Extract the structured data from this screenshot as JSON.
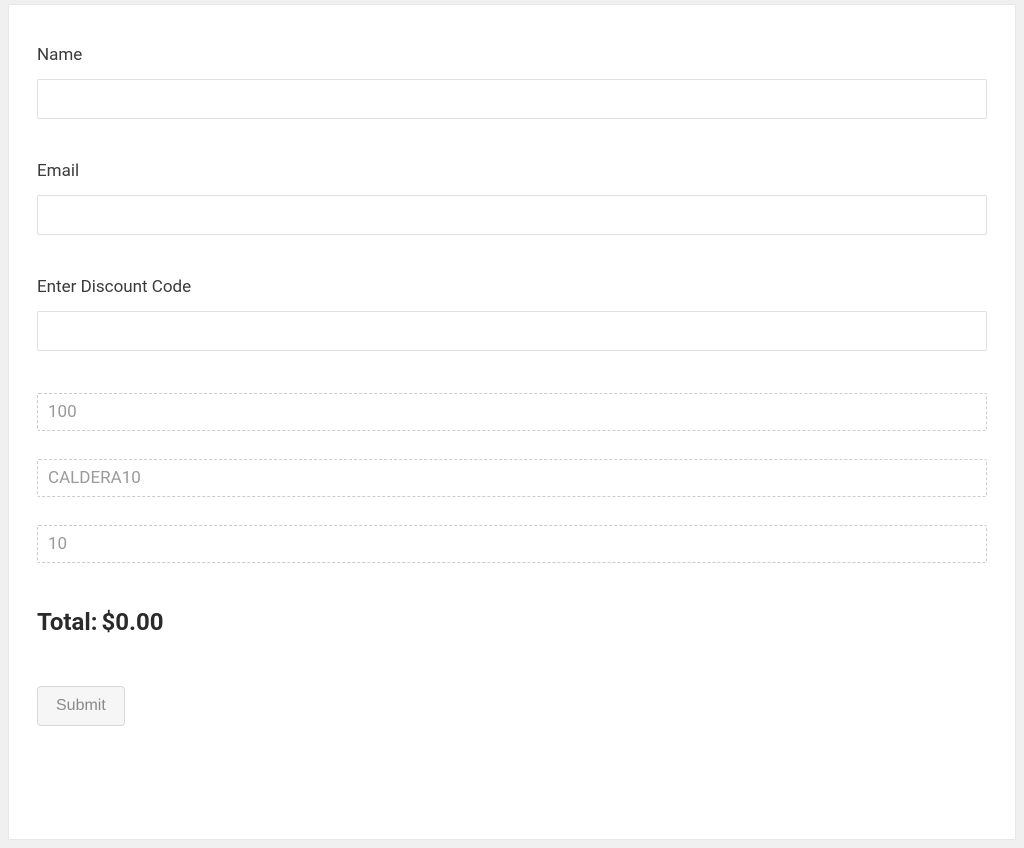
{
  "form": {
    "name": {
      "label": "Name",
      "value": ""
    },
    "email": {
      "label": "Email",
      "value": ""
    },
    "discount": {
      "label": "Enter Discount Code",
      "value": ""
    },
    "hidden_fields": {
      "amount": "100",
      "code": "CALDERA10",
      "percent": "10"
    },
    "total": {
      "label": "Total:",
      "value": "$0.00"
    },
    "submit_label": "Submit"
  }
}
